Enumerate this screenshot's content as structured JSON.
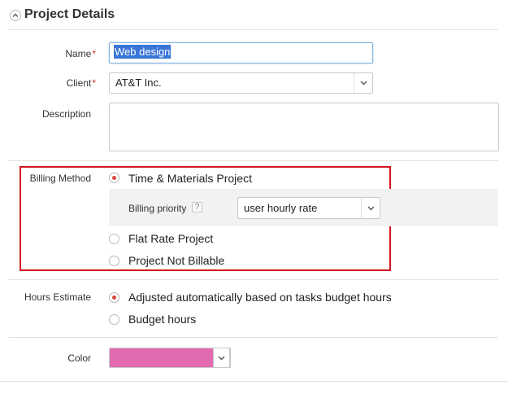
{
  "header": {
    "title": "Project Details"
  },
  "fields": {
    "name": {
      "label": "Name",
      "required_mark": "*",
      "value": "Web design"
    },
    "client": {
      "label": "Client",
      "required_mark": "*",
      "value": "AT&T Inc."
    },
    "description": {
      "label": "Description",
      "value": ""
    }
  },
  "billing": {
    "label": "Billing Method",
    "options": [
      {
        "label": "Time & Materials Project",
        "selected": true
      },
      {
        "label": "Flat Rate Project",
        "selected": false
      },
      {
        "label": "Project Not Billable",
        "selected": false
      }
    ],
    "priority": {
      "label": "Billing priority",
      "help": "?",
      "value": "user hourly rate"
    }
  },
  "hours_estimate": {
    "label": "Hours Estimate",
    "options": [
      {
        "label": "Adjusted automatically based on tasks budget hours",
        "selected": true
      },
      {
        "label": "Budget hours",
        "selected": false
      }
    ]
  },
  "color": {
    "label": "Color",
    "value": "#e26aaf"
  },
  "colors": {
    "required": "#cc3333",
    "radio_selected": "#d7463b",
    "highlight_border": "#d3161f",
    "input_focus": "#7fb2dc"
  }
}
